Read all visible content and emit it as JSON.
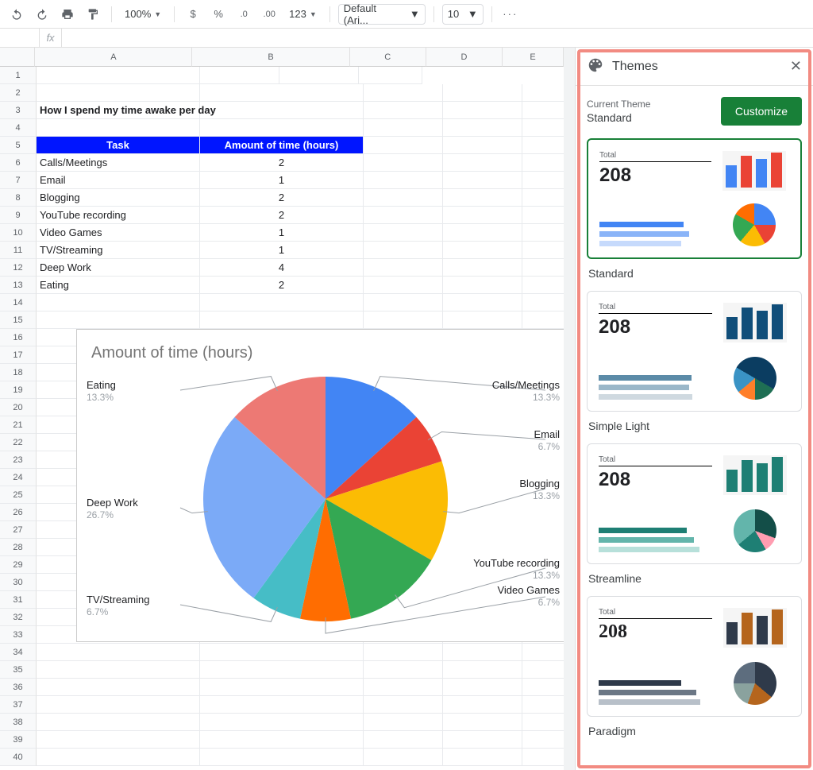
{
  "toolbar": {
    "zoom": "100%",
    "currency": "$",
    "percent": "%",
    "dec_dec": ".0",
    "dec_inc": ".00",
    "num_fmt": "123",
    "font": "Default (Ari...",
    "font_size": "10",
    "more": "···"
  },
  "formula_bar": {
    "fx": "fx",
    "value": ""
  },
  "columns": [
    "A",
    "B",
    "C",
    "D",
    "E"
  ],
  "sheet": {
    "title": "How I spend my time awake per day",
    "headers": {
      "task": "Task",
      "amount": "Amount of time (hours)"
    },
    "rows": [
      {
        "task": "Calls/Meetings",
        "hours": "2"
      },
      {
        "task": "Email",
        "hours": "1"
      },
      {
        "task": "Blogging",
        "hours": "2"
      },
      {
        "task": "YouTube recording",
        "hours": "2"
      },
      {
        "task": "Video Games",
        "hours": "1"
      },
      {
        "task": "TV/Streaming",
        "hours": "1"
      },
      {
        "task": "Deep Work",
        "hours": "4"
      },
      {
        "task": "Eating",
        "hours": "2"
      }
    ]
  },
  "chart": {
    "title": "Amount of time (hours)",
    "labels": {
      "calls": "Calls/Meetings",
      "calls_pct": "13.3%",
      "email": "Email",
      "email_pct": "6.7%",
      "blog": "Blogging",
      "blog_pct": "13.3%",
      "yt": "YouTube recording",
      "yt_pct": "13.3%",
      "games": "Video Games",
      "games_pct": "6.7%",
      "tv": "TV/Streaming",
      "tv_pct": "6.7%",
      "deep": "Deep Work",
      "deep_pct": "26.7%",
      "eat": "Eating",
      "eat_pct": "13.3%"
    }
  },
  "chart_data": {
    "type": "pie",
    "title": "Amount of time (hours)",
    "categories": [
      "Calls/Meetings",
      "Email",
      "Blogging",
      "YouTube recording",
      "Video Games",
      "TV/Streaming",
      "Deep Work",
      "Eating"
    ],
    "values": [
      2,
      1,
      2,
      2,
      1,
      1,
      4,
      2
    ],
    "percentages": [
      13.3,
      6.7,
      13.3,
      13.3,
      6.7,
      6.7,
      26.7,
      13.3
    ],
    "colors": [
      "#4285f4",
      "#ea4335",
      "#fbbc04",
      "#34a853",
      "#ff6d01",
      "#46bdc6",
      "#7baaf7",
      "#ed7974"
    ]
  },
  "sidebar": {
    "title": "Themes",
    "current_label": "Current Theme",
    "current_value": "Standard",
    "customize": "Customize",
    "preview_total_label": "Total",
    "preview_total_value": "208",
    "themes": [
      {
        "name": "Standard"
      },
      {
        "name": "Simple Light"
      },
      {
        "name": "Streamline"
      },
      {
        "name": "Paradigm"
      }
    ]
  }
}
